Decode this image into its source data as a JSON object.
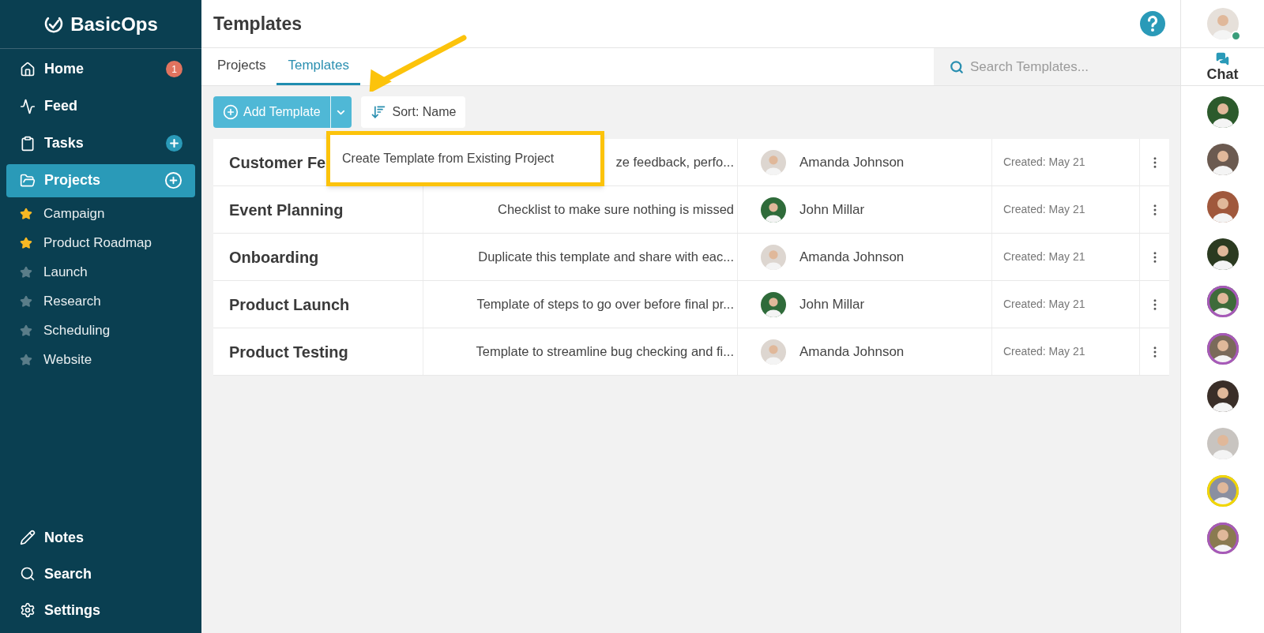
{
  "brand": {
    "name": "BasicOps"
  },
  "nav": [
    {
      "label": "Home",
      "badge": "1",
      "selected": false
    },
    {
      "label": "Feed",
      "selected": false
    },
    {
      "label": "Tasks",
      "add": true,
      "selected": false
    },
    {
      "label": "Projects",
      "add": true,
      "selected": true
    }
  ],
  "projects": [
    {
      "label": "Campaign",
      "starred": true
    },
    {
      "label": "Product Roadmap",
      "starred": true
    },
    {
      "label": "Launch",
      "starred": false
    },
    {
      "label": "Research",
      "starred": false
    },
    {
      "label": "Scheduling",
      "starred": false
    },
    {
      "label": "Website",
      "starred": false
    }
  ],
  "bottom_nav": [
    {
      "label": "Notes"
    },
    {
      "label": "Search"
    },
    {
      "label": "Settings"
    }
  ],
  "header": {
    "title": "Templates"
  },
  "tabs": [
    {
      "label": "Projects",
      "selected": false
    },
    {
      "label": "Templates",
      "selected": true
    }
  ],
  "search": {
    "placeholder": "Search Templates..."
  },
  "toolbar": {
    "add_button": "Add Template",
    "sort_button": "Sort: Name"
  },
  "dropdown": {
    "items": [
      "Create Template from Existing Project"
    ]
  },
  "rows": [
    {
      "name": "Customer Fe",
      "description": "ze feedback, perfo...",
      "owner": "Amanda Johnson",
      "created": "Created: May 21"
    },
    {
      "name": "Event Planning",
      "description": "Checklist to make sure nothing is missed",
      "owner": "John Millar",
      "created": "Created: May 21"
    },
    {
      "name": "Onboarding",
      "description": "Duplicate this template and share with eac...",
      "owner": "Amanda Johnson",
      "created": "Created: May 21"
    },
    {
      "name": "Product Launch",
      "description": "Template of steps to go over before final pr...",
      "owner": "John Millar",
      "created": "Created: May 21"
    },
    {
      "name": "Product Testing",
      "description": "Template to streamline bug checking and fi...",
      "owner": "Amanda Johnson",
      "created": "Created: May 21"
    }
  ],
  "rail": {
    "user_online": true,
    "chat_label": "Chat",
    "people": [
      {
        "ring": false
      },
      {
        "ring": false
      },
      {
        "ring": false
      },
      {
        "ring": false
      },
      {
        "ring": true,
        "color": "#a659b8"
      },
      {
        "ring": true,
        "color": "#a659b8"
      },
      {
        "ring": false
      },
      {
        "ring": false
      },
      {
        "ring": true,
        "color": "#f2d600"
      },
      {
        "ring": true,
        "color": "#a659b8"
      }
    ]
  }
}
